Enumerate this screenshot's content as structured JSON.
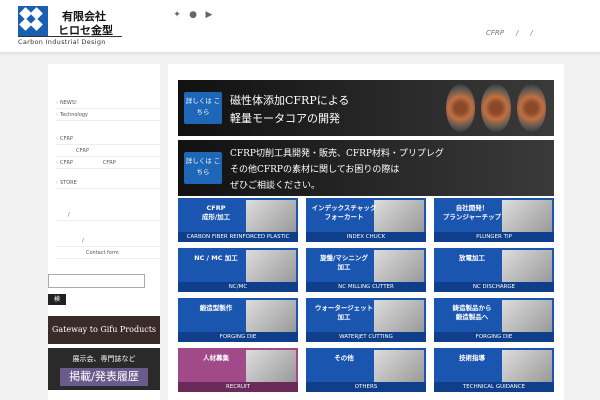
{
  "header": {
    "logo_line1": "有限会社",
    "logo_line2": "ヒロセ金型",
    "logo_sub": "Carbon Industrial Design",
    "social_icons": [
      "twitter-icon",
      "facebook-icon",
      "youtube-icon"
    ],
    "nav": [
      "CFRP",
      "/",
      "/"
    ]
  },
  "sidebar": {
    "menu": [
      "NEWS!",
      "Technology",
      "CFRP",
      "CFRP",
      "CFRP　　　　　　CFRP",
      "STORE",
      "/",
      "/",
      "Contact form"
    ],
    "search_placeholder": "",
    "search_button": "検",
    "banner_gifu": "Gateway to Gifu Products",
    "banner_pub_line1": "展示会、専門誌など",
    "banner_pub_line2": "掲載/発表履歴"
  },
  "hero1": {
    "button": "詳しくは こちら",
    "line1": "磁性体添加CFRPによる",
    "line2": "軽量モータコアの開発"
  },
  "hero2": {
    "button": "詳しくは こちら",
    "line1": "CFRP切削工具開発・販売、CFRP材料・プリプレグ",
    "line2": "その他CFRPの素材に関してお困りの際は",
    "line3": "ぜひご相談ください。"
  },
  "tiles": [
    {
      "title": "CFRP\n成形/加工",
      "foot": "CARBON FIBER REINFORCED PLASTIC"
    },
    {
      "title": "インデックスチャック\nフォーカート",
      "foot": "INDEX CHUCK"
    },
    {
      "title": "自社開発！\nプランジャーチップ",
      "foot": "PLUNGER TIP"
    },
    {
      "title": "NC / MC 加工",
      "foot": "NC/MC"
    },
    {
      "title": "旋盤/マシニング\n加工",
      "foot": "NC MILLING CUTTER"
    },
    {
      "title": "放電加工",
      "foot": "NC DISCHARGE"
    },
    {
      "title": "鍛造型製作",
      "foot": "FORGING DIE"
    },
    {
      "title": "ウォータージェット\n加工",
      "foot": "WATERJET CUTTING"
    },
    {
      "title": "鋳造製品から\n鍛造製品へ",
      "foot": "FORGING DIE"
    },
    {
      "title": "人材募集",
      "foot": "RECRUIT"
    },
    {
      "title": "その他",
      "foot": "OTHERS"
    },
    {
      "title": "技術指導",
      "foot": "TECHNICAL GUIDANCE"
    }
  ],
  "colors": {
    "brand_blue": "#1a55b0",
    "pink": "#a04a8a"
  }
}
